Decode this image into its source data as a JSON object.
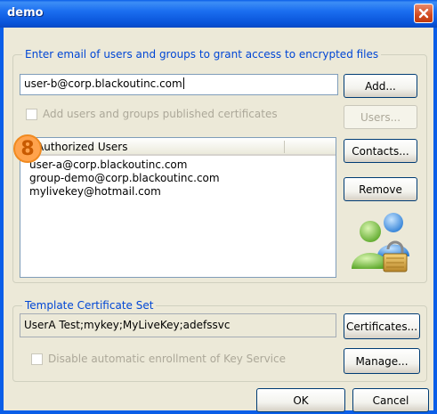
{
  "window": {
    "title": "demo"
  },
  "recipients": {
    "group_label": "Enter email of users and groups to grant access to encrypted files",
    "email_value": "user-b@corp.blackoutinc.com",
    "add_button": "Add...",
    "add_published_checkbox": "Add users and groups published certificates",
    "users_button": "Users...",
    "contacts_button": "Contacts...",
    "remove_button": "Remove",
    "list_header": "Authorized Users",
    "authorized_users": [
      "user-a@corp.blackoutinc.com",
      "group-demo@corp.blackoutinc.com",
      "mylivekey@hotmail.com"
    ],
    "step_badge": "8"
  },
  "template": {
    "group_label": "Template Certificate Set",
    "cert_set_value": "UserA Test;mykey;MyLiveKey;adefssvc",
    "certificates_button": "Certificates...",
    "disable_enrollment_checkbox": "Disable automatic enrollment of Key Service",
    "manage_button": "Manage..."
  },
  "footer": {
    "ok_button": "OK",
    "cancel_button": "Cancel"
  },
  "icons": {
    "close": "close-icon",
    "users": "users-lock-icon"
  },
  "colors": {
    "titlebar": "#0a5ee8",
    "dialog_bg": "#ece9d8",
    "group_label": "#0046d5",
    "badge": "#ffa34d"
  }
}
